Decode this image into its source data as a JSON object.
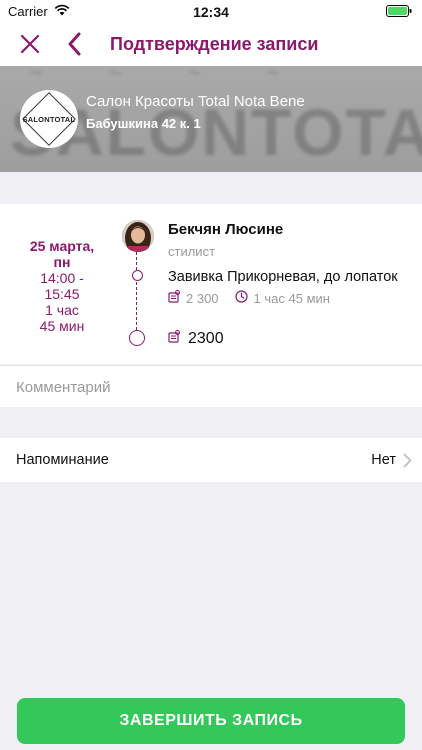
{
  "status_bar": {
    "carrier": "Carrier",
    "time": "12:34"
  },
  "nav": {
    "title": "Подтверждение записи",
    "close_icon": "close-icon",
    "back_icon": "chevron-left-icon"
  },
  "salon": {
    "logo_text": "SALONTOTAL",
    "name": "Салон Красоты Total Nota Bene",
    "address": "Бабушкина 42 к. 1",
    "banner_text": "SALONTOTAL"
  },
  "booking": {
    "date": "25 марта,",
    "weekday": "пн",
    "time_range_start": "14:00 -",
    "time_range_end": "15:45",
    "duration_hours": "1 час",
    "duration_minutes": "45 мин",
    "master_name": "Бекчян Люсине",
    "master_role": "стилист",
    "service_name": "Завивка Прикорневая, до лопаток",
    "service_price": "2 300",
    "service_duration": "1 час 45 мин",
    "total": "2300"
  },
  "comment": {
    "placeholder": "Комментарий",
    "value": ""
  },
  "reminder": {
    "label": "Напоминание",
    "value": "Нет"
  },
  "actions": {
    "finish_label": "ЗАВЕРШИТЬ ЗАПИСЬ"
  },
  "colors": {
    "accent": "#8b1a6b",
    "button": "#34c759",
    "background": "#efeff4"
  }
}
